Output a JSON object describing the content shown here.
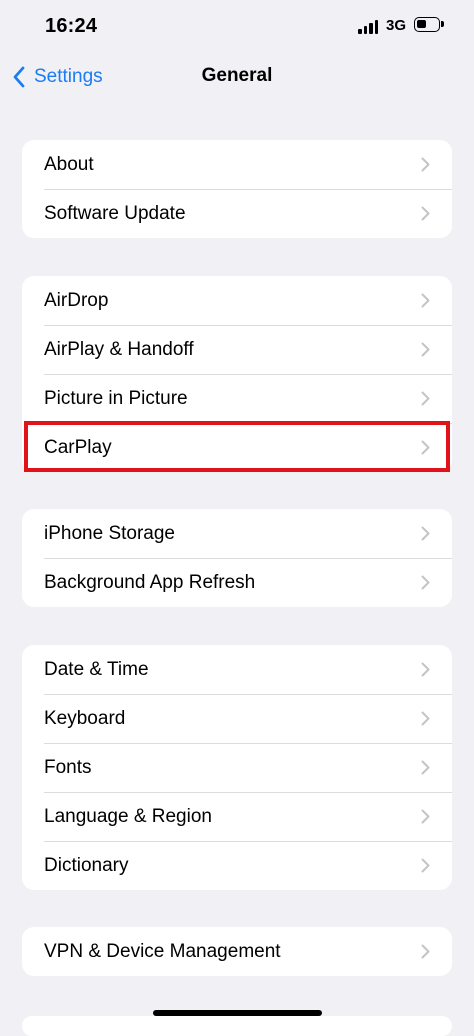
{
  "status_bar": {
    "time": "16:24",
    "network": "3G",
    "battery_level": 0.45
  },
  "nav": {
    "back_label": "Settings",
    "title": "General"
  },
  "groups": [
    {
      "items": [
        {
          "label": "About"
        },
        {
          "label": "Software Update"
        }
      ]
    },
    {
      "items": [
        {
          "label": "AirDrop"
        },
        {
          "label": "AirPlay & Handoff"
        },
        {
          "label": "Picture in Picture"
        },
        {
          "label": "CarPlay"
        }
      ]
    },
    {
      "items": [
        {
          "label": "iPhone Storage"
        },
        {
          "label": "Background App Refresh"
        }
      ]
    },
    {
      "items": [
        {
          "label": "Date & Time"
        },
        {
          "label": "Keyboard"
        },
        {
          "label": "Fonts"
        },
        {
          "label": "Language & Region"
        },
        {
          "label": "Dictionary"
        }
      ]
    },
    {
      "items": [
        {
          "label": "VPN & Device Management"
        }
      ]
    }
  ],
  "highlight": {
    "target": "CarPlay",
    "color": "#e0131a"
  },
  "colors": {
    "background": "#f0f0f5",
    "accent": "#1a7cf5",
    "chevron": "#c4c4c7"
  }
}
